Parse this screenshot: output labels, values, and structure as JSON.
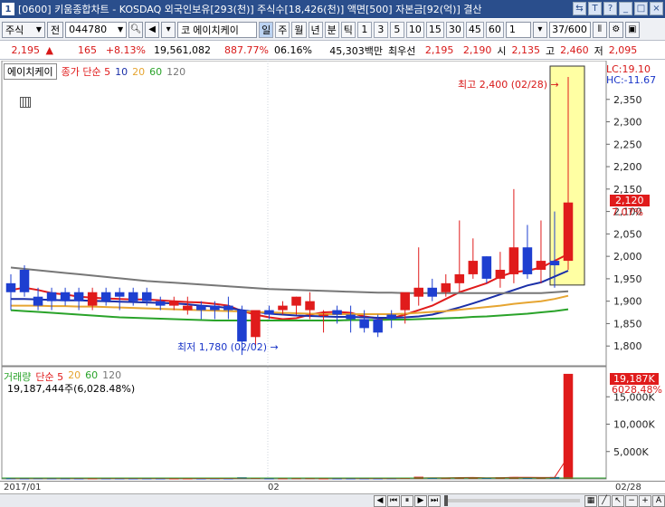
{
  "window": {
    "number": "1",
    "title": "[0600] 키움종합차트 - KOSDAQ 외국인보유[293(천)] 주식수[18,426(천)] 액면[500] 자본금[92(억)] 결산"
  },
  "toolbar": {
    "market": "주식",
    "prev_label": "전",
    "code": "044780",
    "code_prefix": "코",
    "stock_name": "에이치케이",
    "periods": [
      "일",
      "주",
      "월",
      "년",
      "분",
      "틱"
    ],
    "intervals": [
      "1",
      "3",
      "5",
      "10",
      "15",
      "30",
      "45",
      "60"
    ],
    "interval_value": "1",
    "page_count": "37/600"
  },
  "quote": {
    "price": "2,195",
    "change": "165",
    "change_pct": "+8.13%",
    "volume": "19,561,082",
    "vol_ratio": "887.77%",
    "turnover": "06.16%",
    "trade_value": "45,303백만",
    "best_offer_label": "최우선",
    "ask": "2,195",
    "bid": "2,190",
    "open_label": "시",
    "open": "2,135",
    "high_label": "고",
    "high": "2,460",
    "low_label": "저",
    "low": "2,095"
  },
  "price_legend": {
    "name": "에이치케이",
    "type": "종가 단순",
    "ma": [
      "5",
      "10",
      "20",
      "60",
      "120"
    ]
  },
  "volume_legend": {
    "name": "거래량",
    "type": "단순",
    "ma": [
      "5",
      "20",
      "60",
      "120"
    ],
    "info": "19,187,444주(6,028.48%)"
  },
  "annotations": {
    "high": "최고 2,400 (02/28)",
    "low": "최저 1,780 (02/02)",
    "lc": "LC:19.10",
    "hc": "HC:-11.67",
    "cur_price": "2,120",
    "cur_pct": "7.07%",
    "vol_tag": "19,187K",
    "vol_pct": "6028.48%"
  },
  "dates": {
    "start": "2017/01",
    "mid": "02",
    "end": "02/28"
  },
  "colors": {
    "up": "#e01b1b",
    "down": "#1e3fd0",
    "ma5": "#e01b1b",
    "ma10": "#1a2fa8",
    "ma20": "#e6a531",
    "ma60": "#2aa32a",
    "ma120": "#777777"
  },
  "chart_data": [
    {
      "type": "candlestick",
      "title": "",
      "ylim": [
        1760,
        2400
      ],
      "y_ticks": [
        2350,
        2300,
        2250,
        2200,
        2150,
        2100,
        2050,
        2000,
        1950,
        1900,
        1850,
        1800
      ],
      "candles": [
        {
          "o": 1940,
          "h": 1960,
          "l": 1880,
          "c": 1920
        },
        {
          "o": 1970,
          "h": 1980,
          "l": 1910,
          "c": 1920
        },
        {
          "o": 1910,
          "h": 1930,
          "l": 1880,
          "c": 1890
        },
        {
          "o": 1920,
          "h": 1930,
          "l": 1880,
          "c": 1900
        },
        {
          "o": 1920,
          "h": 1930,
          "l": 1890,
          "c": 1900
        },
        {
          "o": 1920,
          "h": 1930,
          "l": 1880,
          "c": 1900
        },
        {
          "o": 1890,
          "h": 1930,
          "l": 1880,
          "c": 1920
        },
        {
          "o": 1920,
          "h": 1930,
          "l": 1890,
          "c": 1900
        },
        {
          "o": 1920,
          "h": 1930,
          "l": 1880,
          "c": 1910
        },
        {
          "o": 1920,
          "h": 1930,
          "l": 1890,
          "c": 1900
        },
        {
          "o": 1920,
          "h": 1930,
          "l": 1890,
          "c": 1900
        },
        {
          "o": 1900,
          "h": 1910,
          "l": 1880,
          "c": 1890
        },
        {
          "o": 1890,
          "h": 1910,
          "l": 1880,
          "c": 1900
        },
        {
          "o": 1880,
          "h": 1910,
          "l": 1870,
          "c": 1890
        },
        {
          "o": 1890,
          "h": 1900,
          "l": 1860,
          "c": 1880
        },
        {
          "o": 1890,
          "h": 1900,
          "l": 1860,
          "c": 1880
        },
        {
          "o": 1890,
          "h": 1910,
          "l": 1860,
          "c": 1880
        },
        {
          "o": 1880,
          "h": 1890,
          "l": 1780,
          "c": 1810
        },
        {
          "o": 1820,
          "h": 1870,
          "l": 1800,
          "c": 1880
        },
        {
          "o": 1880,
          "h": 1890,
          "l": 1860,
          "c": 1870
        },
        {
          "o": 1880,
          "h": 1900,
          "l": 1870,
          "c": 1890
        },
        {
          "o": 1890,
          "h": 1910,
          "l": 1870,
          "c": 1910
        },
        {
          "o": 1880,
          "h": 1920,
          "l": 1860,
          "c": 1900
        },
        {
          "o": 1870,
          "h": 1880,
          "l": 1830,
          "c": 1870
        },
        {
          "o": 1880,
          "h": 1890,
          "l": 1850,
          "c": 1870
        },
        {
          "o": 1870,
          "h": 1890,
          "l": 1830,
          "c": 1860
        },
        {
          "o": 1860,
          "h": 1880,
          "l": 1830,
          "c": 1840
        },
        {
          "o": 1860,
          "h": 1870,
          "l": 1820,
          "c": 1830
        },
        {
          "o": 1870,
          "h": 1880,
          "l": 1840,
          "c": 1860
        },
        {
          "o": 1880,
          "h": 1910,
          "l": 1850,
          "c": 1920
        },
        {
          "o": 1910,
          "h": 2020,
          "l": 1890,
          "c": 1930
        },
        {
          "o": 1930,
          "h": 1950,
          "l": 1900,
          "c": 1910
        },
        {
          "o": 1920,
          "h": 1960,
          "l": 1910,
          "c": 1940
        },
        {
          "o": 1940,
          "h": 2080,
          "l": 1920,
          "c": 1960
        },
        {
          "o": 1960,
          "h": 2040,
          "l": 1950,
          "c": 1990
        },
        {
          "o": 2000,
          "h": 2000,
          "l": 1940,
          "c": 1950
        },
        {
          "o": 1950,
          "h": 2010,
          "l": 1930,
          "c": 1970
        },
        {
          "o": 1960,
          "h": 2150,
          "l": 1940,
          "c": 2020
        },
        {
          "o": 2020,
          "h": 2070,
          "l": 1950,
          "c": 1960
        },
        {
          "o": 1970,
          "h": 2080,
          "l": 1940,
          "c": 1990
        },
        {
          "o": 1990,
          "h": 2100,
          "l": 1930,
          "c": 1980
        },
        {
          "o": 1990,
          "h": 2400,
          "l": 1970,
          "c": 2120
        }
      ],
      "ma_series": [
        {
          "name": "5",
          "values": [
            1925,
            1930,
            1925,
            1918,
            1915,
            1910,
            1908,
            1906,
            1905,
            1904,
            1904,
            1902,
            1900,
            1898,
            1897,
            1894,
            1890,
            1878,
            1870,
            1864,
            1860,
            1862,
            1870,
            1875,
            1876,
            1874,
            1866,
            1862,
            1862,
            1870,
            1880,
            1890,
            1905,
            1920,
            1930,
            1940,
            1955,
            1965,
            1968,
            1975,
            1990,
            2005
          ]
        },
        {
          "name": "10",
          "values": [
            1905,
            1905,
            1904,
            1903,
            1902,
            1902,
            1901,
            1900,
            1899,
            1898,
            1897,
            1896,
            1895,
            1893,
            1890,
            1888,
            1885,
            1880,
            1876,
            1872,
            1870,
            1868,
            1867,
            1866,
            1865,
            1865,
            1864,
            1863,
            1863,
            1864,
            1866,
            1870,
            1878,
            1886,
            1895,
            1905,
            1915,
            1925,
            1935,
            1942,
            1955,
            1968
          ]
        },
        {
          "name": "20",
          "values": [
            1890,
            1890,
            1890,
            1889,
            1889,
            1888,
            1888,
            1887,
            1886,
            1885,
            1884,
            1883,
            1882,
            1881,
            1880,
            1879,
            1878,
            1877,
            1876,
            1875,
            1874,
            1873,
            1872,
            1871,
            1871,
            1871,
            1871,
            1871,
            1871,
            1872,
            1874,
            1876,
            1878,
            1881,
            1884,
            1887,
            1890,
            1894,
            1897,
            1900,
            1905,
            1912
          ]
        },
        {
          "name": "60",
          "values": [
            1880,
            1878,
            1876,
            1874,
            1872,
            1870,
            1868,
            1866,
            1864,
            1863,
            1862,
            1861,
            1860,
            1859,
            1858,
            1857,
            1857,
            1857,
            1857,
            1857,
            1857,
            1857,
            1857,
            1857,
            1857,
            1858,
            1858,
            1858,
            1859,
            1859,
            1860,
            1861,
            1862,
            1863,
            1865,
            1866,
            1868,
            1870,
            1872,
            1875,
            1878,
            1882
          ]
        },
        {
          "name": "120",
          "values": [
            1975,
            1972,
            1969,
            1966,
            1963,
            1960,
            1957,
            1954,
            1951,
            1948,
            1945,
            1943,
            1941,
            1939,
            1937,
            1935,
            1933,
            1931,
            1929,
            1927,
            1926,
            1925,
            1924,
            1923,
            1922,
            1921,
            1920,
            1919,
            1919,
            1918,
            1918,
            1918,
            1918,
            1918,
            1918,
            1918,
            1918,
            1918,
            1918,
            1918,
            1920,
            1922
          ]
        }
      ]
    },
    {
      "type": "bar",
      "title": "",
      "ylim": [
        0,
        20000
      ],
      "y_ticks": [
        15000,
        10000,
        5000
      ],
      "y_tick_labels": [
        "15,000K",
        "10,000K",
        "5,000K"
      ],
      "values": [
        120,
        100,
        130,
        110,
        100,
        90,
        110,
        100,
        100,
        90,
        100,
        90,
        90,
        90,
        80,
        90,
        90,
        300,
        200,
        100,
        110,
        130,
        140,
        90,
        90,
        90,
        100,
        90,
        120,
        240,
        400,
        200,
        150,
        240,
        300,
        180,
        300,
        350,
        240,
        250,
        350,
        19187
      ]
    }
  ]
}
